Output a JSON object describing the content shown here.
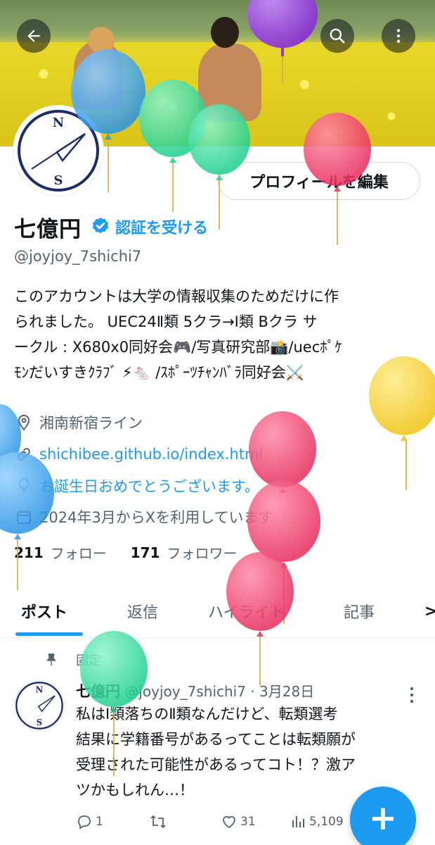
{
  "header": {
    "back_icon": "arrow-left-icon",
    "search_icon": "search-icon",
    "more_icon": "more-vertical-icon"
  },
  "profile": {
    "edit_button_label": "プロフィールを編集",
    "name": "七億円",
    "verify_label": "認証を受ける",
    "handle": "@joyjoy_7shichi7",
    "bio_lines": [
      "このアカウントは大学の情報収集のためだけに作",
      "られました。 UEC24Ⅱ類 5クラ→Ⅰ類 Bクラ サ",
      "ークル : X680x0同好会🎮/写真研究部📸/uecﾎﾟｹ",
      "ﾓﾝだいすきｸﾗﾌﾞ ⚡🐁 /ｽﾎﾟｰﾂﾁｬﾝﾊﾞﾗ同好会⚔️"
    ],
    "location": "湘南新宿ライン",
    "website": "shichibee.github.io/index.html",
    "birthday": "お誕生日おめでとうございます。",
    "joined": "2024年3月からXを利用しています",
    "following_count": "211",
    "following_label": "フォロー",
    "followers_count": "171",
    "followers_label": "フォロワー"
  },
  "tabs": [
    {
      "label": "ポスト",
      "active": true
    },
    {
      "label": "返信",
      "active": false
    },
    {
      "label": "ハイライト",
      "active": false
    },
    {
      "label": "記事",
      "active": false
    }
  ],
  "tabs_more": ">",
  "post": {
    "pinned_label": "固定",
    "author": "七億円",
    "handle_date": "@joyjoy_7shichi7 · 3月28日",
    "text_lines": [
      "私はⅠ類落ちのⅡ類なんだけど、転類選考",
      "結果に学籍番号があるってことは転類願が",
      "受理された可能性があるってコト！？激ア",
      "ツかもしれん…！"
    ],
    "replies": "1",
    "reposts": "",
    "likes": "31",
    "views": "5,109"
  },
  "fab_label": "+",
  "colors": {
    "accent": "#1d9bf0",
    "text": "#0f1419",
    "secondary": "#536471",
    "balloon_blue": "#3ea6ef",
    "balloon_green": "#2fe0a0",
    "balloon_red": "#ef3f6a",
    "balloon_yellow": "#f7d437",
    "balloon_purple": "#9b3fe0"
  }
}
